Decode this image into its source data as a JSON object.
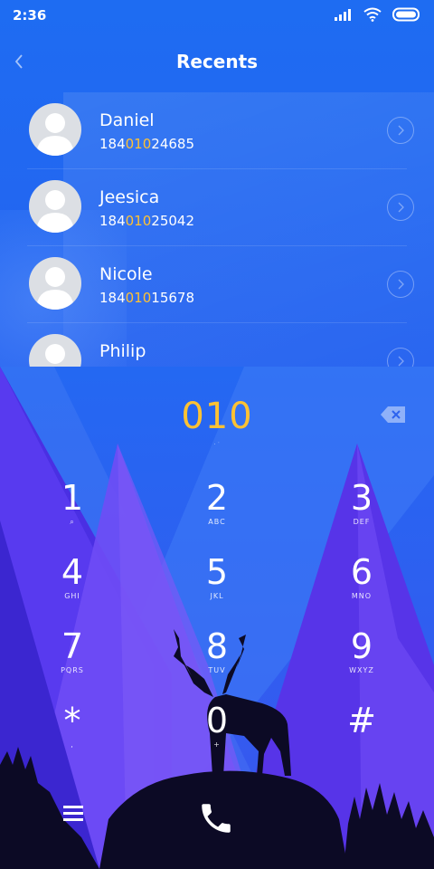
{
  "status_bar": {
    "time": "2:36",
    "icons": [
      "signal-icon",
      "wifi-icon",
      "battery-icon"
    ]
  },
  "header": {
    "title": "Recents",
    "back_icon": "chevron-left-icon"
  },
  "recents": [
    {
      "name": "Daniel",
      "number_prefix": "184",
      "number_match": "010",
      "number_suffix": "24685"
    },
    {
      "name": "Jeesica",
      "number_prefix": "184",
      "number_match": "010",
      "number_suffix": "25042"
    },
    {
      "name": "Nicole",
      "number_prefix": "184",
      "number_match": "010",
      "number_suffix": "15678"
    },
    {
      "name": "Philip",
      "number_prefix": "",
      "number_match": "",
      "number_suffix": ""
    }
  ],
  "dialer": {
    "entered_number": "010",
    "sub_text": "· ˙",
    "keys": [
      {
        "digit": "1",
        "letters": "⌕"
      },
      {
        "digit": "2",
        "letters": "ABC"
      },
      {
        "digit": "3",
        "letters": "DEF"
      },
      {
        "digit": "4",
        "letters": "GHI"
      },
      {
        "digit": "5",
        "letters": "JKL"
      },
      {
        "digit": "6",
        "letters": "MNO"
      },
      {
        "digit": "7",
        "letters": "PQRS"
      },
      {
        "digit": "8",
        "letters": "TUV"
      },
      {
        "digit": "9",
        "letters": "WXYZ"
      },
      {
        "digit": "*",
        "letters": ","
      },
      {
        "digit": "0",
        "letters": "+"
      },
      {
        "digit": "#",
        "letters": ""
      }
    ]
  },
  "colors": {
    "accent": "#ffc233",
    "background": "#1f6bf0",
    "dialer_purple": "#5b3df0"
  }
}
